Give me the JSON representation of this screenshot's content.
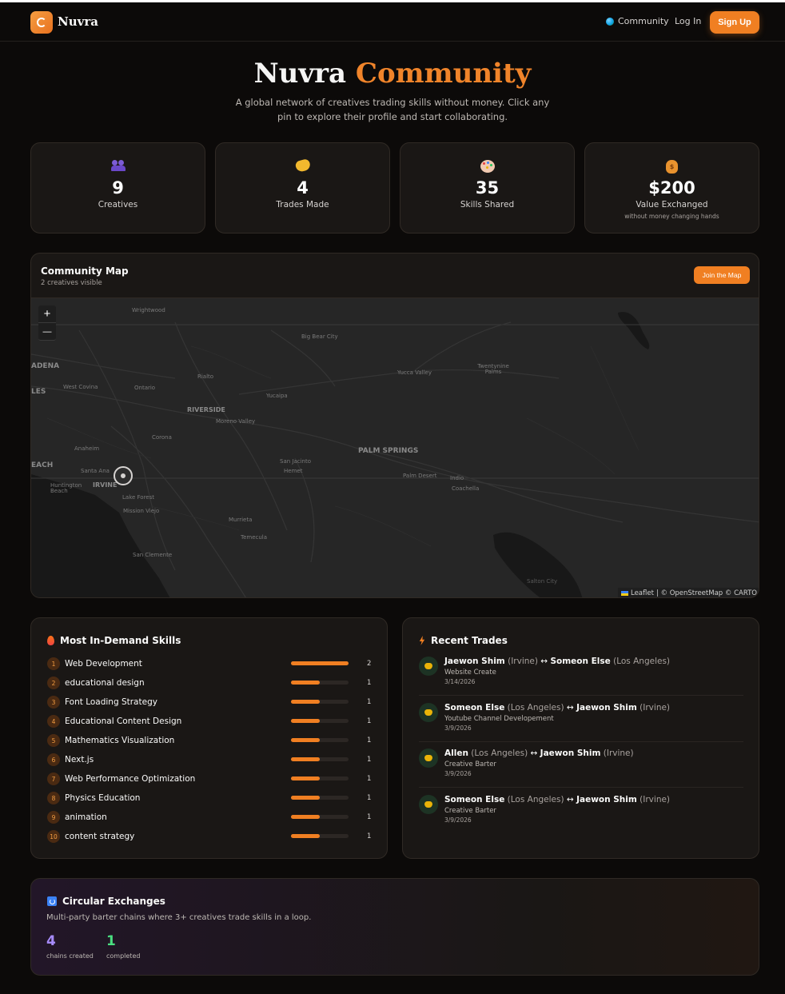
{
  "nav": {
    "brand": "Nuvra",
    "community": "Community",
    "login": "Log In",
    "signup": "Sign Up"
  },
  "hero": {
    "title_main": "Nuvra",
    "title_accent": "Community",
    "subtitle": "A global network of creatives trading skills without money. Click any pin to explore their profile and start collaborating."
  },
  "stats": [
    {
      "icon": "people-icon",
      "value": "9",
      "label": "Creatives",
      "sub": ""
    },
    {
      "icon": "handshake-icon",
      "value": "4",
      "label": "Trades Made",
      "sub": ""
    },
    {
      "icon": "palette-icon",
      "value": "35",
      "label": "Skills Shared",
      "sub": ""
    },
    {
      "icon": "money-bag-icon",
      "value": "$200",
      "label": "Value Exchanged",
      "sub": "without money changing hands"
    }
  ],
  "map": {
    "title": "Community Map",
    "subtitle": "2 creatives visible",
    "join": "Join the Map",
    "zoom_in": "+",
    "zoom_out": "—",
    "attribution_leaflet": "Leaflet",
    "attribution_rest": "| © OpenStreetMap © CARTO",
    "places": {
      "wrightwood": "Wrightwood",
      "big_bear": "Big Bear City",
      "adena": "ADENA",
      "les": "LES",
      "west_covina": "West Covina",
      "ontario": "Ontario",
      "rialto": "Rialto",
      "yucca": "Yucca Valley",
      "twentynine": "Twentynine Palms",
      "yucaipa": "Yucaipa",
      "riverside": "RIVERSIDE",
      "moreno": "Moreno Valley",
      "corona": "Corona",
      "anaheim": "Anaheim",
      "palm_springs": "PALM SPRINGS",
      "san_jacinto": "San Jacinto",
      "hemet": "Hemet",
      "each": "EACH",
      "santa_ana": "Santa Ana",
      "palm_desert": "Palm Desert",
      "indio": "Indio",
      "coachella": "Coachella",
      "huntington": "Huntington Beach",
      "irvine": "IRVINE",
      "lake_forest": "Lake Forest",
      "mission_viejo": "Mission Viejo",
      "murrieta": "Murrieta",
      "temecula": "Temecula",
      "san_clemente": "San Clemente",
      "salton": "Salton City"
    }
  },
  "skills": {
    "title": "Most In-Demand Skills",
    "items": [
      {
        "rank": "1",
        "name": "Web Development",
        "count": "2",
        "fill": 1.0
      },
      {
        "rank": "2",
        "name": "educational design",
        "count": "1",
        "fill": 0.5
      },
      {
        "rank": "3",
        "name": "Font Loading Strategy",
        "count": "1",
        "fill": 0.5
      },
      {
        "rank": "4",
        "name": "Educational Content Design",
        "count": "1",
        "fill": 0.5
      },
      {
        "rank": "5",
        "name": "Mathematics Visualization",
        "count": "1",
        "fill": 0.5
      },
      {
        "rank": "6",
        "name": "Next.js",
        "count": "1",
        "fill": 0.5
      },
      {
        "rank": "7",
        "name": "Web Performance Optimization",
        "count": "1",
        "fill": 0.5
      },
      {
        "rank": "8",
        "name": "Physics Education",
        "count": "1",
        "fill": 0.5
      },
      {
        "rank": "9",
        "name": "animation",
        "count": "1",
        "fill": 0.5
      },
      {
        "rank": "10",
        "name": "content strategy",
        "count": "1",
        "fill": 0.5
      }
    ]
  },
  "trades": {
    "title": "Recent Trades",
    "arrow": "↔",
    "items": [
      {
        "from": "Jaewon Shim",
        "from_loc": "(Irvine)",
        "to": "Someon Else",
        "to_loc": "(Los Angeles)",
        "desc": "Website Create",
        "date": "3/14/2026"
      },
      {
        "from": "Someon Else",
        "from_loc": "(Los Angeles)",
        "to": "Jaewon Shim",
        "to_loc": "(Irvine)",
        "desc": "Youtube Channel Developement",
        "date": "3/9/2026"
      },
      {
        "from": "Allen",
        "from_loc": "(Los Angeles)",
        "to": "Jaewon Shim",
        "to_loc": "(Irvine)",
        "desc": "Creative Barter",
        "date": "3/9/2026"
      },
      {
        "from": "Someon Else",
        "from_loc": "(Los Angeles)",
        "to": "Jaewon Shim",
        "to_loc": "(Irvine)",
        "desc": "Creative Barter",
        "date": "3/9/2026"
      }
    ]
  },
  "circular": {
    "title": "Circular Exchanges",
    "subtitle": "Multi-party barter chains where 3+ creatives trade skills in a loop.",
    "chains_value": "4",
    "chains_label": "chains created",
    "completed_value": "1",
    "completed_label": "completed"
  }
}
